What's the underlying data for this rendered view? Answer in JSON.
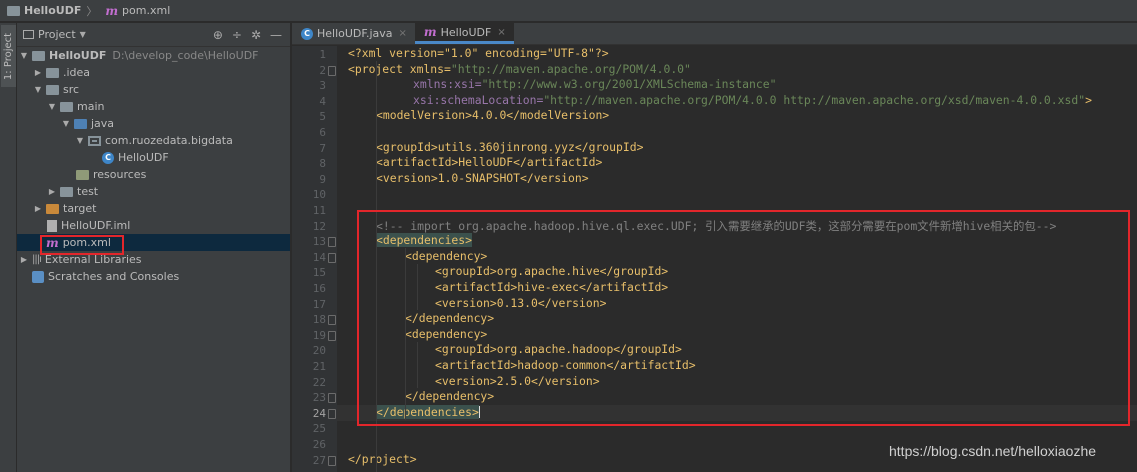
{
  "breadcrumb": {
    "project": "HelloUDF",
    "file": "pom.xml"
  },
  "side_strip": {
    "tab_label": "1: Project"
  },
  "project_panel": {
    "title": "Project",
    "tree": [
      {
        "label": "HelloUDF",
        "path": "D:\\develop_code\\HelloUDF"
      },
      {
        "label": ".idea"
      },
      {
        "label": "src"
      },
      {
        "label": "main"
      },
      {
        "label": "java"
      },
      {
        "label": "com.ruozedata.bigdata"
      },
      {
        "label": "HelloUDF"
      },
      {
        "label": "resources"
      },
      {
        "label": "test"
      },
      {
        "label": "target"
      },
      {
        "label": "HelloUDF.iml"
      },
      {
        "label": "pom.xml"
      },
      {
        "label": "External Libraries"
      },
      {
        "label": "Scratches and Consoles"
      }
    ]
  },
  "editor": {
    "tabs": [
      {
        "label": "HelloUDF.java",
        "close": "×"
      },
      {
        "label": "HelloUDF",
        "close": "×"
      }
    ],
    "line_numbers": [
      "1",
      "2",
      "3",
      "4",
      "5",
      "6",
      "7",
      "8",
      "9",
      "10",
      "11",
      "12",
      "13",
      "14",
      "15",
      "16",
      "17",
      "18",
      "19",
      "20",
      "21",
      "22",
      "23",
      "24",
      "25",
      "26",
      "27"
    ],
    "current_line": 24,
    "code": {
      "l1": "<?xml version=\"1.0\" encoding=\"UTF-8\"?>",
      "l2_tag": "<project xmlns=",
      "l2_val": "\"http://maven.apache.org/POM/4.0.0\"",
      "l3_attr": "xmlns:xsi=",
      "l3_val": "\"http://www.w3.org/2001/XMLSchema-instance\"",
      "l4_attr": "xsi:schemaLocation=",
      "l4_val": "\"http://maven.apache.org/POM/4.0.0 http://maven.apache.org/xsd/maven-4.0.0.xsd\"",
      "l4_end": ">",
      "l5": "<modelVersion>4.0.0</modelVersion>",
      "l7": "<groupId>utils.360jinrong.yyz</groupId>",
      "l8": "<artifactId>HelloUDF</artifactId>",
      "l9": "<version>1.0-SNAPSHOT</version>",
      "l12": "<!-- import org.apache.hadoop.hive.ql.exec.UDF; 引入需要继承的UDF类，这部分需要在pom文件新增hive相关的包-->",
      "l13": "<dependencies>",
      "l14": "<dependency>",
      "l15": "<groupId>org.apache.hive</groupId>",
      "l16": "<artifactId>hive-exec</artifactId>",
      "l17": "<version>0.13.0</version>",
      "l18": "</dependency>",
      "l19": "<dependency>",
      "l20": "<groupId>org.apache.hadoop</groupId>",
      "l21": "<artifactId>hadoop-common</artifactId>",
      "l22": "<version>2.5.0</version>",
      "l23": "</dependency>",
      "l24": "</dependencies>",
      "l27": "</project>"
    }
  },
  "watermark": "https://blog.csdn.net/helloxiaozhe"
}
